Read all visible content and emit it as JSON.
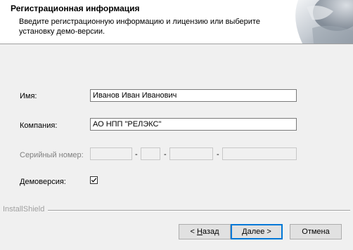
{
  "header": {
    "title": "Регистрационная информация",
    "description": "Введите регистрационную информацию и лицензию или выберите установку демо-версии."
  },
  "form": {
    "name_label": "Имя:",
    "name_value": "Иванов Иван Иванович",
    "company_label": "Компания:",
    "company_value": "АО НПП \"РЕЛЭКС\"",
    "serial_label": "Серийный номер:",
    "serial_parts": [
      "",
      "",
      "",
      ""
    ],
    "serial_separator": "-",
    "demo_label": "Демоверсия:",
    "demo_checked": true
  },
  "footer": {
    "installshield_label": "InstallShield",
    "back_prefix": "< ",
    "back_mnemonic": "Н",
    "back_rest": "азад",
    "next_mnemonic": "Д",
    "next_rest": "алее >",
    "cancel_label": "Отмена"
  }
}
